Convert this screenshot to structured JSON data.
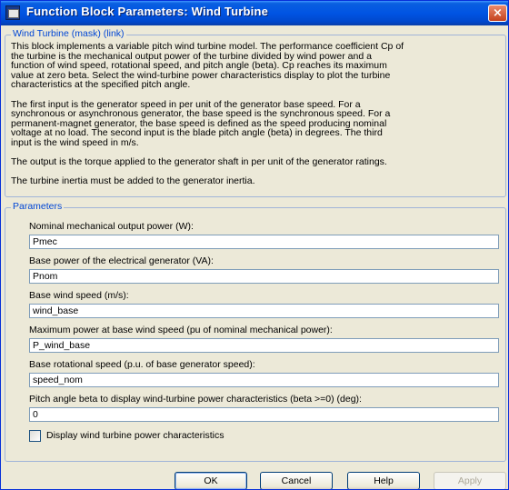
{
  "window": {
    "title": "Function Block Parameters: Wind Turbine",
    "close_glyph": "×"
  },
  "mask": {
    "group_title": "Wind Turbine (mask) (link)",
    "description_lines": [
      "This block implements a variable pitch wind turbine model. The performance coefficient Cp of",
      "the turbine is the mechanical output power of the turbine divided by wind power and a",
      "function of wind speed, rotational speed, and pitch angle (beta). Cp reaches its maximum",
      "value at zero beta. Select the wind-turbine power characteristics display to plot the turbine",
      "characteristics at the specified pitch angle.",
      "",
      "The first input is the generator speed in per unit of the generator base speed. For a",
      "synchronous or asynchronous generator, the base speed is the synchronous speed. For a",
      "permanent-magnet generator, the base speed is defined as the speed producing nominal",
      "voltage at  no load. The second input is the blade pitch angle (beta) in degrees. The third",
      "input is the wind speed in m/s.",
      "",
      "The output is the torque applied to the generator shaft in per unit of the generator ratings.",
      "",
      "The turbine inertia must be added to the generator inertia."
    ]
  },
  "parameters": {
    "group_title": "Parameters",
    "fields": [
      {
        "label": "Nominal mechanical output power (W):",
        "value": "Pmec"
      },
      {
        "label": "Base power of the electrical generator (VA):",
        "value": "Pnom"
      },
      {
        "label": "Base wind speed (m/s):",
        "value": "wind_base"
      },
      {
        "label": "Maximum power at base wind speed (pu of nominal mechanical power):",
        "value": "P_wind_base"
      },
      {
        "label": "Base rotational speed (p.u. of base generator speed):",
        "value": "speed_nom"
      },
      {
        "label": "Pitch angle beta to display wind-turbine power characteristics (beta >=0)  (deg):",
        "value": "0"
      }
    ],
    "checkbox": {
      "label": "Display wind turbine power characteristics",
      "checked": false
    }
  },
  "buttons": {
    "ok": "OK",
    "cancel": "Cancel",
    "help": "Help",
    "apply": "Apply"
  }
}
